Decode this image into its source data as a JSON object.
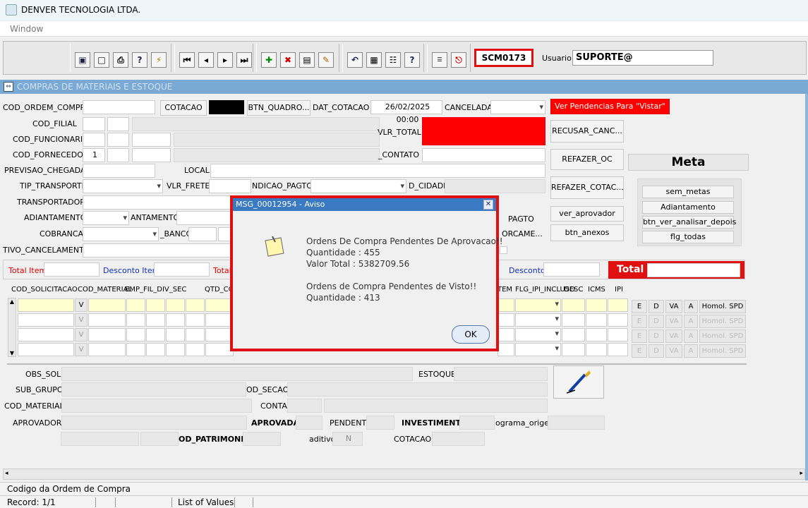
{
  "window": {
    "title": "DENVER TECNOLOGIA LTDA."
  },
  "menu": {
    "window": "Window"
  },
  "toolbar": {
    "screen_code": "SCM0173",
    "user_label": "Usuario",
    "user_value": "SUPORTE@"
  },
  "form": {
    "title": "COMPRAS DE MATERIAIS E ESTOQUE"
  },
  "header": {
    "cod_ordem_compra": "COD_ORDEM_COMPRA",
    "cotacao": "COTACAO",
    "btn_quadro": "BTN_QUADRO...",
    "dat_cotacao": "DAT_COTACAO",
    "dat_cotacao_value": "26/02/2025 00:00",
    "cancelada": "CANCELADA",
    "ver_pendencias": "Ver Pendencias Para \"Vistar\"",
    "cod_filial": "COD_FILIAL",
    "vlr_total": "VLR_TOTAL",
    "cod_funcionario": "COD_FUNCIONARIO",
    "cod_fornecedor": "COD_FORNECEDOR",
    "cod_fornecedor_value": "1",
    "contato": "_CONTATO",
    "previsao_chegada": "PREVISAO_CHEGADA",
    "local": "LOCAL",
    "tip_transporte": "TIP_TRANSPORTE",
    "vlr_frete": "VLR_FRETE",
    "indicao_pagto": "NDICAO_PAGTO",
    "cidade": "D_CIDADE",
    "transportador": "TRANSPORTADOR",
    "adiantamento": "ADIANTAMENTO",
    "antamento": "ANTAMENTO",
    "pagto": "PAGTO",
    "cobranca": "COBRANCA",
    "banco": "_BANCO",
    "orcame": "ORCAME...",
    "motivo_cancelamento": "TIVO_CANCELAMENTO"
  },
  "side_buttons": {
    "recusar": "RECUSAR_CANC...",
    "refazer_oc": "REFAZER_OC",
    "refazer_cotac": "REFAZER_COTAC...",
    "ver_aprovador": "ver_aprovador",
    "btn_anexos": "btn_anexos",
    "meta": "Meta",
    "sem_metas": "sem_metas",
    "adiantamento": "Adiantamento",
    "btn_ver_analisar": "btn_ver_analisar_depois",
    "flg_todas": "flg_todas"
  },
  "totals": {
    "total_item": "Total Item",
    "desconto_item": "Desconto Item",
    "total": "Total",
    "desconto": "Desconto",
    "total_big": "Total"
  },
  "grid": {
    "headers": [
      "COD_SOLICITACAO",
      "COD_MATERIAL",
      "EMP_FIL_DIV_SEC",
      "QTD_CO",
      "TEM",
      "FLG_IPI_INCLUSO",
      "DESC",
      "ICMS",
      "IPI"
    ],
    "row_v": "V",
    "row_buttons": [
      "E",
      "D",
      "VA",
      "A",
      "Homol. SPD"
    ]
  },
  "footer": {
    "obs_sol": "OBS_SOL",
    "estoque": "ESTOQUE",
    "sub_grupo": "SUB_GRUPO",
    "cod_secao": "OD_SECAO",
    "cod_material": "COD_MATERIAL",
    "conta": "CONTA",
    "aprovador": "APROVADOR",
    "aprovada": "APROVADA",
    "pendente": "PENDENTE",
    "investimento": "INVESTIMENTO",
    "programa_origem": "ograma_origem",
    "cod_patrimonio": "OD_PATRIMONIO",
    "aditivo": "aditivo",
    "aditivo_value": "N",
    "cotacao": "COTACAO"
  },
  "dialog": {
    "title": "MSG_00012954 - Aviso",
    "line1": "Ordens De Compra Pendentes De Aprovacao!!",
    "line2": " Quantidade  : 455",
    "line3": " Valor Total : 5382709.56",
    "line4": "Ordens de Compra Pendentes de Visto!!",
    "line5": "Quantidade  : 413",
    "ok": "OK"
  },
  "status": {
    "hint": "Codigo da Ordem de Compra",
    "record": "Record: 1/1",
    "lov": "List of Values"
  },
  "colors": {
    "accent": "#3a7ac2",
    "alert": "#ff0000",
    "formbar": "#7aa9d4"
  }
}
